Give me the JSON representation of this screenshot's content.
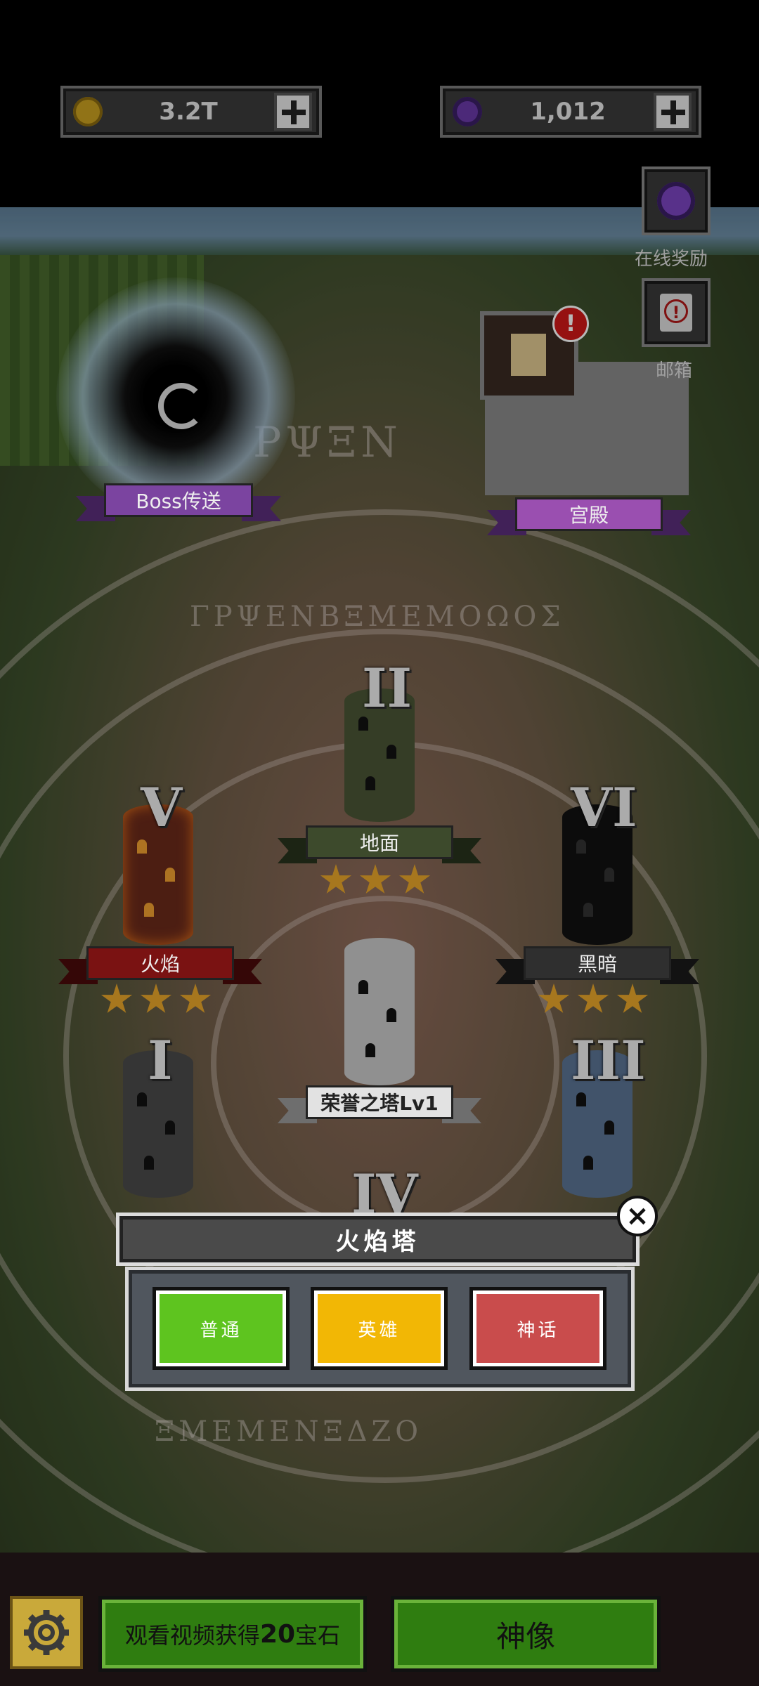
{
  "currencies": {
    "gold": {
      "value": "3.2T",
      "icon": "gold-coin-icon",
      "color": "#d4a017"
    },
    "gems": {
      "value": "1,012",
      "icon": "purple-gem-icon",
      "color": "#7b3fb8"
    }
  },
  "side_buttons": {
    "online_reward": {
      "label": "在线奖励",
      "icon": "purple-gem-icon"
    },
    "mailbox": {
      "label": "邮箱",
      "icon": "mail-alert-icon"
    }
  },
  "map": {
    "boss_portal": {
      "label": "Boss传送"
    },
    "palace": {
      "label": "宫殿"
    },
    "towers": [
      {
        "numeral": "II",
        "label": "地面",
        "stars": 3,
        "color": "#3d4a2c"
      },
      {
        "numeral": "V",
        "label": "火焰",
        "stars": 3,
        "color": "#7a1212"
      },
      {
        "numeral": "VI",
        "label": "黑暗",
        "stars": 3,
        "color": "#2f2f2f"
      },
      {
        "numeral": "",
        "label": "荣誉之塔Lv1",
        "stars": 0,
        "color": "#cfcfcf"
      },
      {
        "numeral": "I",
        "label": "",
        "stars": 0,
        "color": "#4a4a4a"
      },
      {
        "numeral": "III",
        "label": "",
        "stars": 0,
        "color": "#3b4d66"
      },
      {
        "numeral": "IV",
        "label": "",
        "stars": 0,
        "color": "#4b5a70"
      }
    ]
  },
  "modal": {
    "title": "火焰塔",
    "buttons": [
      {
        "label": "普通",
        "color": "#5ec41f"
      },
      {
        "label": "英雄",
        "color": "#f2b705"
      },
      {
        "label": "神话",
        "color": "#c94c4c"
      }
    ]
  },
  "bottom_bar": {
    "settings_icon": "gear-icon",
    "watch_video": {
      "prefix": "观看视频获得",
      "amount": "20",
      "suffix": "宝石"
    },
    "statue": {
      "label": "神像"
    }
  }
}
